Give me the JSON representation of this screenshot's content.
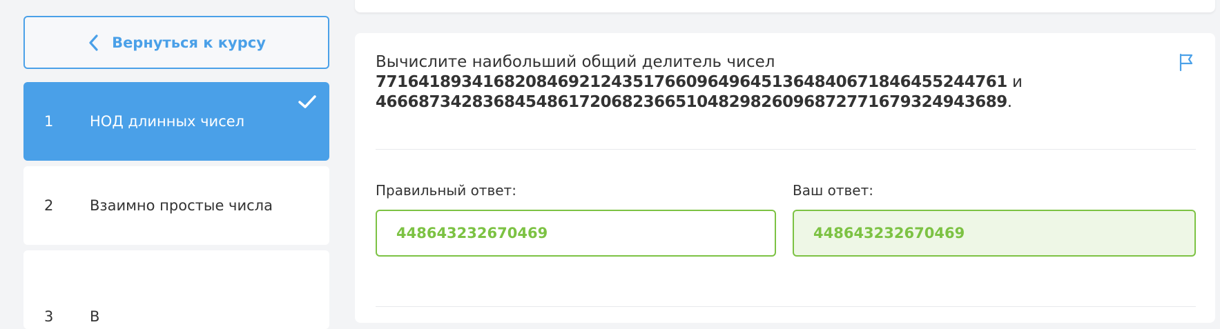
{
  "sidebar": {
    "back_label": "Вернуться к курсу",
    "steps": [
      {
        "number": "1",
        "label": "НОД длинных чисел",
        "completed": true
      },
      {
        "number": "2",
        "label": "Взаимно простые числа"
      },
      {
        "number": "3",
        "label": "В"
      }
    ]
  },
  "problem": {
    "intro": "Вычислите наибольший общий делитель чисел",
    "number_a": "77164189341682084692124351766096496451364840671846455244761",
    "conjunction": " и",
    "number_b": "46668734283684548617206823665104829826096872771679324943689",
    "end": "."
  },
  "answers": {
    "correct_label": "Правильный ответ:",
    "correct_value": "448643232670469",
    "user_label": "Ваш ответ:",
    "user_value": "448643232670469"
  },
  "colors": {
    "accent": "#4aa0e8",
    "success": "#7cc243",
    "success_bg": "#eef7e6"
  },
  "icons": {
    "back": "chevron-left-icon",
    "done": "checkmark-icon",
    "report": "flag-icon"
  }
}
